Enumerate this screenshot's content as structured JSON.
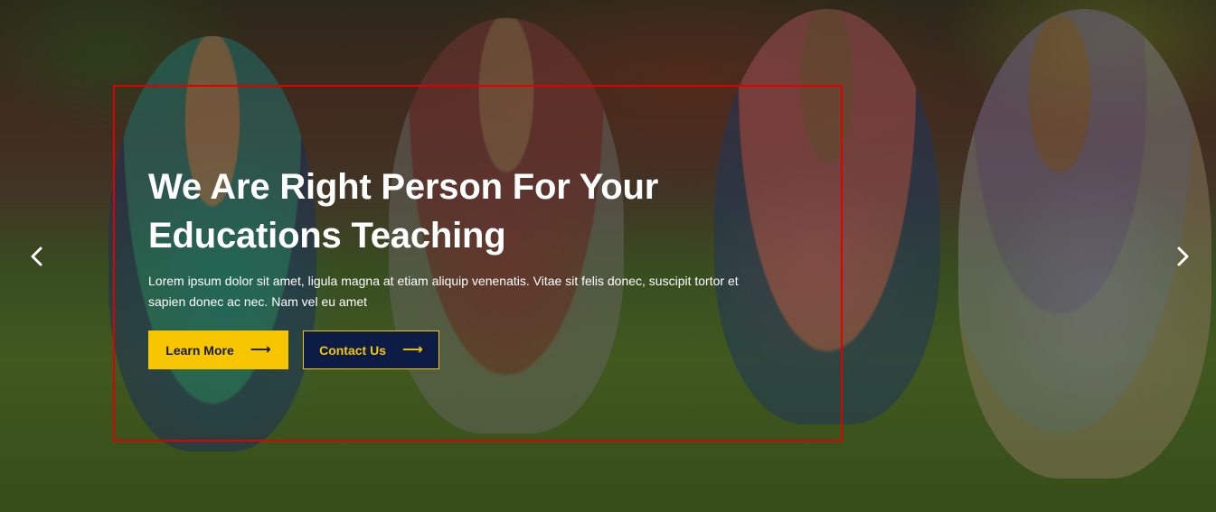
{
  "hero": {
    "title_line1": "We Are Right Person For Your",
    "title_line2": "Educations Teaching",
    "subtitle": "Lorem ipsum dolor sit amet, ligula magna at etiam aliquip venenatis. Vitae sit felis donec, suscipit tortor et sapien donec ac nec. Nam vel eu amet",
    "learn_more_label": "Learn More",
    "contact_us_label": "Contact Us",
    "arrow_glyph": "⟶"
  },
  "icons": {
    "prev": "chevron-left-icon",
    "next": "chevron-right-icon",
    "button_arrow": "arrow-right-icon"
  },
  "colors": {
    "accent_yellow": "#f7c600",
    "navy": "#0c1c44",
    "highlight_frame": "#e00000"
  }
}
